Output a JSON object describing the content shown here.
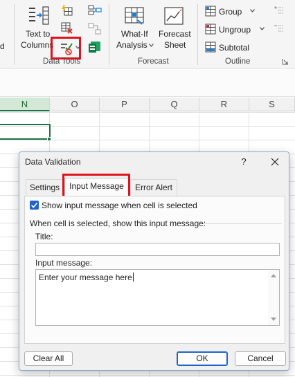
{
  "ribbon": {
    "partial_left_label": "d",
    "data_tools": {
      "text_to_columns_line1": "Text to",
      "text_to_columns_line2": "Columns",
      "group_label": "Data Tools"
    },
    "forecast": {
      "what_if_line1": "What-If",
      "what_if_line2": "Analysis",
      "forecast_sheet_line1": "Forecast",
      "forecast_sheet_line2": "Sheet",
      "group_label": "Forecast"
    },
    "outline": {
      "group": "Group",
      "ungroup": "Ungroup",
      "subtotal": "Subtotal",
      "group_label": "Outline"
    }
  },
  "sheet": {
    "columns": [
      "N",
      "O",
      "P",
      "Q",
      "R",
      "S"
    ],
    "selected_column": "N"
  },
  "dialog": {
    "title": "Data Validation",
    "help": "?",
    "tabs": [
      "Settings",
      "Input Message",
      "Error Alert"
    ],
    "active_tab": "Input Message",
    "show_message_label": "Show input message when cell is selected",
    "show_message_checked": true,
    "section_label": "When cell is selected, show this input message:",
    "title_label": "Title:",
    "title_value": "",
    "message_label": "Input message:",
    "message_value": "Enter your message here",
    "buttons": {
      "clear_all": "Clear All",
      "ok": "OK",
      "cancel": "Cancel"
    }
  },
  "colors": {
    "highlight": "#e0121b",
    "excel_green": "#217346",
    "accent_blue": "#1e64c8"
  }
}
